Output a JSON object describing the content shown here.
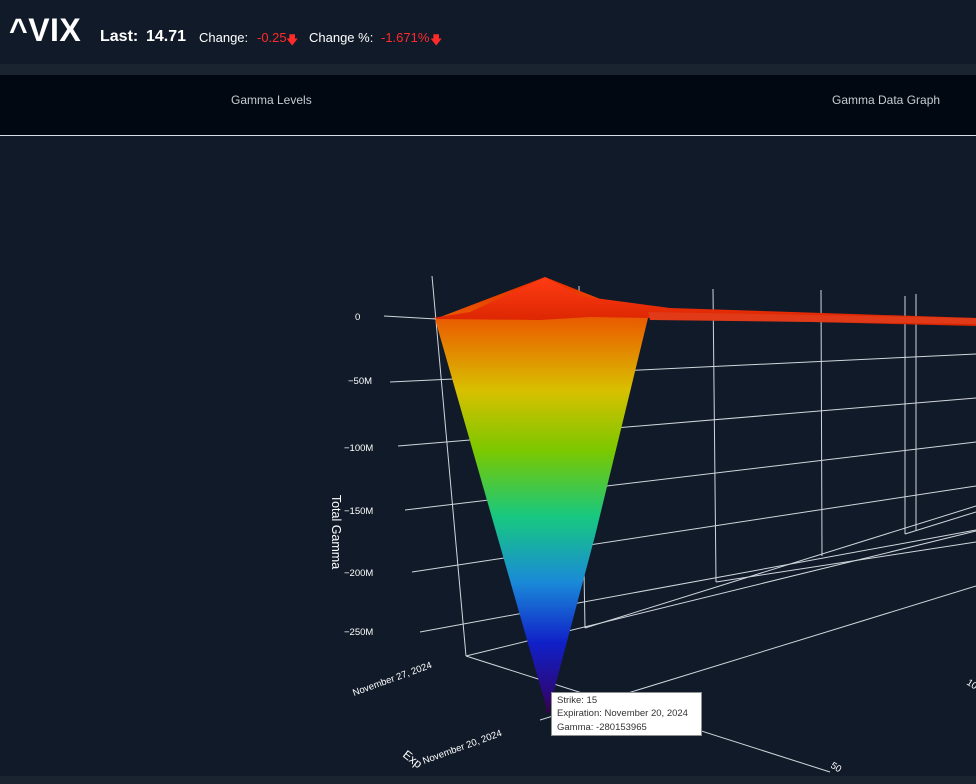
{
  "header": {
    "ticker": "^VIX",
    "last_label": "Last:",
    "last_value": "14.71",
    "change_label": "Change:",
    "change_value": "-0.25",
    "change_pct_label": "Change %:",
    "change_pct_value": "-1.671%",
    "down_icon": "down-arrow-icon",
    "down_color": "#ff2a2a"
  },
  "tabs": [
    {
      "label": "Gamma Levels"
    },
    {
      "label": "Gamma Data Graph"
    }
  ],
  "chart_data": {
    "type": "surface3d",
    "z_label": "Total Gamma",
    "z_ticks": [
      "0",
      "−50M",
      "−100M",
      "−150M",
      "−200M",
      "−250M"
    ],
    "y_label": "Exp",
    "y_ticks": [
      "November 27, 2024",
      "November 20, 2024"
    ],
    "x_ticks": [
      "50",
      "10"
    ],
    "colorscale": "jet",
    "point_annotations": [
      {
        "strike": 15,
        "expiration": "November 20, 2024",
        "gamma": -280153965
      }
    ],
    "tooltip": {
      "line1": "Strike: 15",
      "line2": "Expiration: November 20, 2024",
      "line3": "Gamma: -280153965"
    }
  }
}
